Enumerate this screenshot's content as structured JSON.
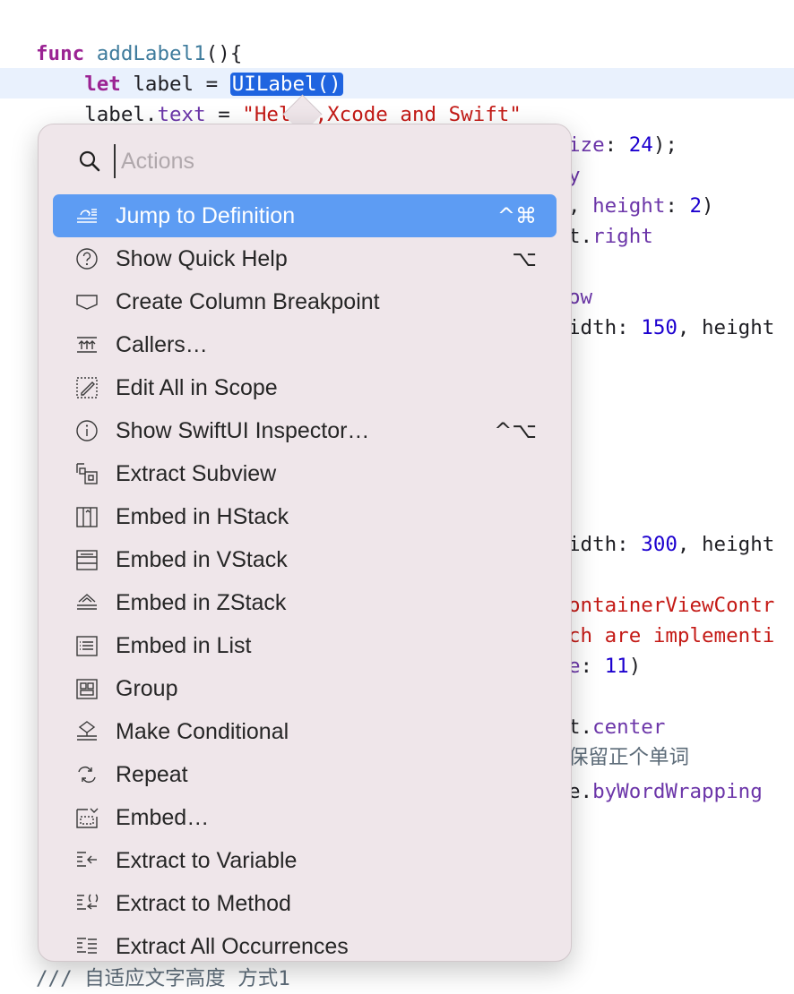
{
  "code": {
    "lines": [
      {
        "segments": [
          {
            "t": "func",
            "c": "kw"
          },
          {
            "t": " "
          },
          {
            "t": "addLabel1",
            "c": "fn"
          },
          {
            "t": "(){"
          }
        ]
      },
      {
        "segments": [
          {
            "t": "    "
          },
          {
            "t": "let",
            "c": "kw"
          },
          {
            "t": " label = "
          },
          {
            "t": "UILabel()",
            "c": "sel"
          }
        ]
      },
      {
        "segments": [
          {
            "t": "    label."
          },
          {
            "t": "text",
            "c": "prop"
          },
          {
            "t": " = "
          },
          {
            "t": "\"Hello,Xcode and Swift\"",
            "c": "str"
          }
        ]
      }
    ],
    "right_fragments": [
      {
        "segments": [
          {
            "t": "ize",
            "c": "prop"
          },
          {
            "t": ": "
          },
          {
            "t": "24",
            "c": "num"
          },
          {
            "t": ");"
          }
        ]
      },
      {
        "segments": [
          {
            "t": "y",
            "c": "prop"
          }
        ]
      },
      {
        "segments": [
          {
            "t": ", "
          },
          {
            "t": "height",
            "c": "prop"
          },
          {
            "t": ": "
          },
          {
            "t": "2",
            "c": "num"
          },
          {
            "t": ")"
          }
        ]
      },
      {
        "segments": [
          {
            "t": "t."
          },
          {
            "t": "right",
            "c": "prop"
          }
        ]
      },
      {
        "segments": [
          {
            "t": "ow",
            "c": "prop"
          }
        ]
      },
      {
        "segments": [
          {
            "t": "idth: "
          },
          {
            "t": "150",
            "c": "num"
          },
          {
            "t": ", height"
          }
        ]
      },
      {
        "segments": [
          {
            "t": "idth: "
          },
          {
            "t": "300",
            "c": "num"
          },
          {
            "t": ", height"
          }
        ]
      },
      {
        "segments": [
          {
            "t": "ontainerViewContr",
            "c": "str"
          }
        ]
      },
      {
        "segments": [
          {
            "t": "ch are implementi",
            "c": "str"
          }
        ]
      },
      {
        "segments": [
          {
            "t": "e",
            "c": "prop"
          },
          {
            "t": ": "
          },
          {
            "t": "11",
            "c": "num"
          },
          {
            "t": ")"
          }
        ]
      },
      {
        "segments": [
          {
            "t": "t."
          },
          {
            "t": "center",
            "c": "prop"
          }
        ]
      },
      {
        "segments": [
          {
            "t": "保留正个单词",
            "c": "cm"
          }
        ]
      },
      {
        "segments": [
          {
            "t": "e."
          },
          {
            "t": "byWordWrapping",
            "c": "prop"
          }
        ]
      }
    ],
    "bottom_comment": "/// 自适应文字高度 方式1"
  },
  "popup": {
    "search": {
      "placeholder": "Actions",
      "value": ""
    },
    "items": [
      {
        "name": "jump-to-definition",
        "label": "Jump to Definition",
        "shortcut": "^⌘",
        "icon": "jump-definition-icon",
        "active": true
      },
      {
        "name": "show-quick-help",
        "label": "Show Quick Help",
        "shortcut": "⌥",
        "icon": "question-circle-icon",
        "active": false
      },
      {
        "name": "create-column-breakpoint",
        "label": "Create Column Breakpoint",
        "shortcut": "",
        "icon": "breakpoint-icon",
        "active": false
      },
      {
        "name": "callers",
        "label": "Callers…",
        "shortcut": "",
        "icon": "callers-icon",
        "active": false
      },
      {
        "name": "edit-all-in-scope",
        "label": "Edit All in Scope",
        "shortcut": "",
        "icon": "edit-scope-icon",
        "active": false
      },
      {
        "name": "show-swiftui-inspector",
        "label": "Show SwiftUI Inspector…",
        "shortcut": "^⌥",
        "icon": "info-circle-icon",
        "active": false
      },
      {
        "name": "extract-subview",
        "label": "Extract Subview",
        "shortcut": "",
        "icon": "extract-subview-icon",
        "active": false
      },
      {
        "name": "embed-in-hstack",
        "label": "Embed in HStack",
        "shortcut": "",
        "icon": "hstack-icon",
        "active": false
      },
      {
        "name": "embed-in-vstack",
        "label": "Embed in VStack",
        "shortcut": "",
        "icon": "vstack-icon",
        "active": false
      },
      {
        "name": "embed-in-zstack",
        "label": "Embed in ZStack",
        "shortcut": "",
        "icon": "zstack-icon",
        "active": false
      },
      {
        "name": "embed-in-list",
        "label": "Embed in List",
        "shortcut": "",
        "icon": "list-icon",
        "active": false
      },
      {
        "name": "group",
        "label": "Group",
        "shortcut": "",
        "icon": "group-icon",
        "active": false
      },
      {
        "name": "make-conditional",
        "label": "Make Conditional",
        "shortcut": "",
        "icon": "conditional-icon",
        "active": false
      },
      {
        "name": "repeat",
        "label": "Repeat",
        "shortcut": "",
        "icon": "repeat-icon",
        "active": false
      },
      {
        "name": "embed",
        "label": "Embed…",
        "shortcut": "",
        "icon": "embed-icon",
        "active": false
      },
      {
        "name": "extract-to-variable",
        "label": "Extract to Variable",
        "shortcut": "",
        "icon": "extract-variable-icon",
        "active": false
      },
      {
        "name": "extract-to-method",
        "label": "Extract to Method",
        "shortcut": "",
        "icon": "extract-method-icon",
        "active": false
      },
      {
        "name": "extract-all-occurrences",
        "label": "Extract All Occurrences",
        "shortcut": "",
        "icon": "extract-all-icon",
        "active": false
      }
    ]
  },
  "colors": {
    "selection": "#1f64e0",
    "active_row": "#5d9cf3",
    "popup_bg": "#efe6ea",
    "current_line": "#e9f1fd"
  }
}
